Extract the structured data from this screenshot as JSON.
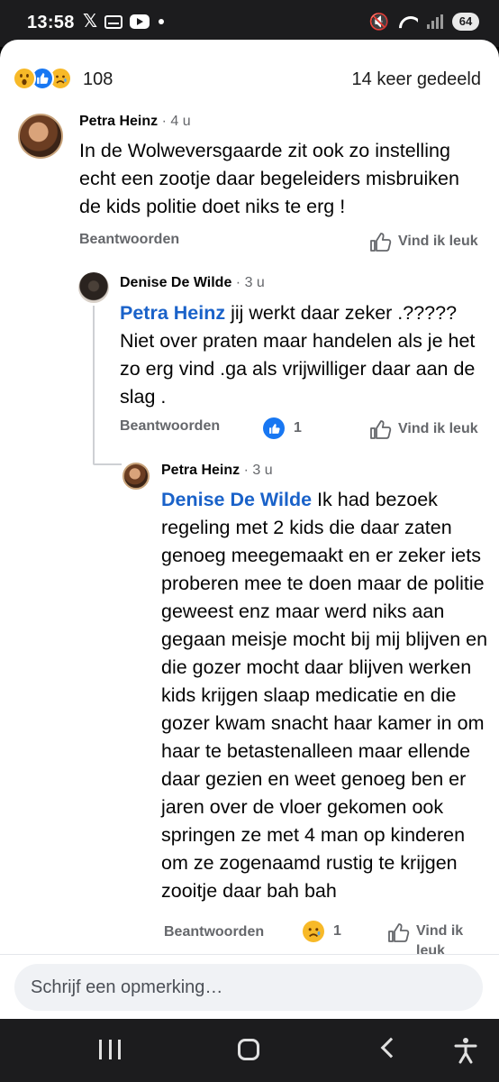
{
  "status_bar": {
    "time": "13:58",
    "left_icons": [
      "x-logo-icon",
      "mail-icon",
      "youtube-icon",
      "notification-dot-icon"
    ],
    "right_icons": [
      "mute-icon",
      "wifi-icon",
      "signal-icon"
    ],
    "battery": "64"
  },
  "post_stats": {
    "reaction_icons": [
      "wow-reaction-icon",
      "like-reaction-icon",
      "sad-reaction-icon"
    ],
    "reaction_count": "108",
    "shares": "14 keer gedeeld"
  },
  "comments": [
    {
      "author": "Petra Heinz",
      "time": " · 4 u",
      "text": "In de Wolweversgaarde zit ook zo instelling echt een zootje daar  begeleiders misbruiken de kids politie doet niks te erg !",
      "reply_label": "Beantwoorden",
      "like_label": "Vind ik leuk"
    },
    {
      "author": "Denise De Wilde",
      "time": " · 3 u",
      "mention": "Petra Heinz",
      "text": " jij werkt daar zeker .????? Niet over praten maar handelen als je het zo erg vind .ga als vrijwilliger daar aan de slag .",
      "reply_label": "Beantwoorden",
      "reaction_count": "1",
      "like_label": "Vind ik leuk"
    },
    {
      "author": "Petra Heinz",
      "time": " · 3 u",
      "mention": "Denise De Wilde",
      "text": " Ik had bezoek regeling met 2 kids die daar zaten genoeg meegemaakt en er zeker iets proberen mee te doen maar de politie geweest enz maar werd niks aan gegaan meisje mocht bij mij blijven en die gozer mocht daar blijven werken kids krijgen slaap medicatie en die gozer kwam snacht haar kamer in om haar te betastenalleen maar ellende daar gezien en weet genoeg ben er jaren over de vloer gekomen  ook springen ze met 4 man op kinderen om ze zogenaamd rustig te krijgen zooitje daar bah bah",
      "reply_label": "Beantwoorden",
      "reaction_count": "1",
      "like_label": "Vind ik leuk"
    }
  ],
  "composer": {
    "placeholder": "Schrijf een opmerking…"
  },
  "nav_bar": {
    "icons": [
      "recents-icon",
      "home-icon",
      "back-icon",
      "accessibility-icon"
    ]
  }
}
